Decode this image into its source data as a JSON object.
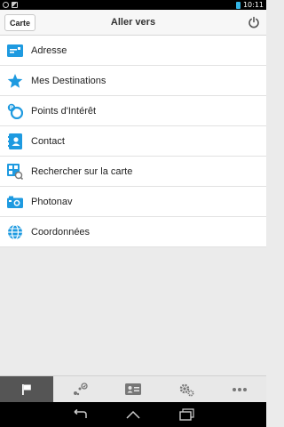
{
  "status": {
    "time": "10:11"
  },
  "header": {
    "back_label": "Carte",
    "title": "Aller vers"
  },
  "menu": [
    {
      "label": "Adresse",
      "icon": "address-card-icon"
    },
    {
      "label": "Mes Destinations",
      "icon": "star-icon"
    },
    {
      "label": "Points d'Intérêt",
      "icon": "poi-icon"
    },
    {
      "label": "Contact",
      "icon": "contact-book-icon"
    },
    {
      "label": "Rechercher sur la carte",
      "icon": "map-search-icon"
    },
    {
      "label": "Photonav",
      "icon": "camera-icon"
    },
    {
      "label": "Coordonnées",
      "icon": "globe-icon"
    }
  ],
  "tabs": [
    {
      "icon": "flag-icon",
      "active": true
    },
    {
      "icon": "route-icon",
      "active": false
    },
    {
      "icon": "id-card-icon",
      "active": false
    },
    {
      "icon": "settings-icon",
      "active": false
    },
    {
      "icon": "more-icon",
      "active": false
    }
  ],
  "colors": {
    "accent": "#1e9ae0",
    "active_tab": "#555555"
  }
}
